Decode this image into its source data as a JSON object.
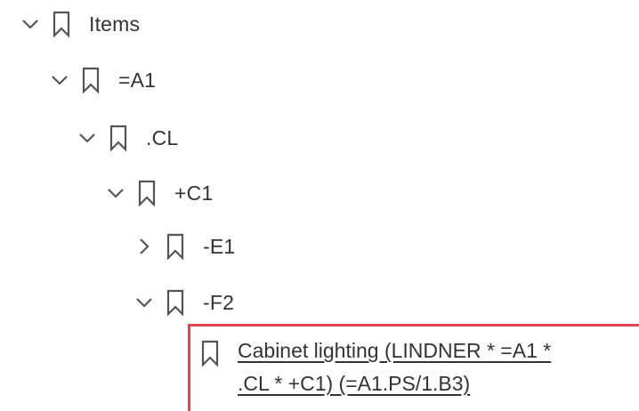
{
  "tree": {
    "items": [
      {
        "label": "Items",
        "state": "expanded",
        "level": 0
      },
      {
        "label": "=A1",
        "state": "expanded",
        "level": 1
      },
      {
        "label": ".CL",
        "state": "expanded",
        "level": 2
      },
      {
        "label": "+C1",
        "state": "expanded",
        "level": 3
      },
      {
        "label": "-E1",
        "state": "collapsed",
        "level": 4
      },
      {
        "label": "-F2",
        "state": "expanded",
        "level": 4
      }
    ],
    "selected_item": {
      "line1": "Cabinet lighting (LINDNER * =A1 *",
      "line2": ".CL * +C1) (=A1.PS/1.B3)"
    },
    "icons": {
      "expand": "chevron-down-icon",
      "collapse": "chevron-right-icon",
      "bookmark": "bookmark-icon"
    },
    "colors": {
      "highlight_border": "#e8434b",
      "icon_stroke": "#555555"
    }
  }
}
